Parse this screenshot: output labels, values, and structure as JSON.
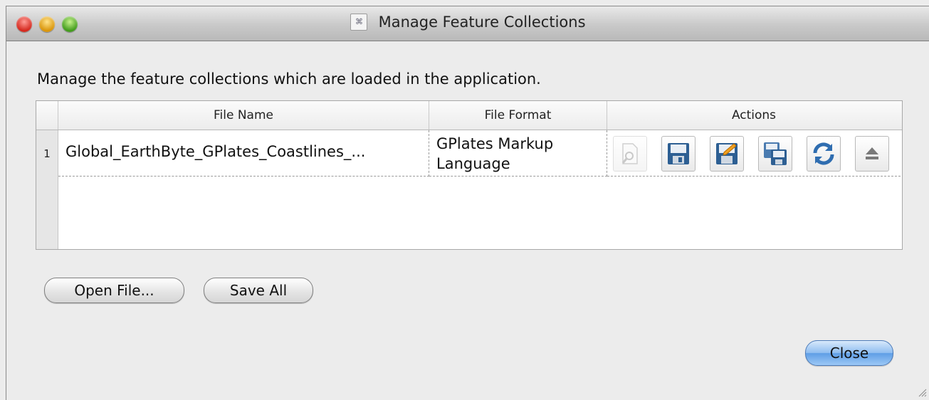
{
  "window": {
    "title": "Manage Feature Collections",
    "title_icon": "app-icon"
  },
  "description": "Manage the feature collections which are loaded in the application.",
  "table": {
    "columns": [
      "File Name",
      "File Format",
      "Actions"
    ],
    "rows": [
      {
        "index": "1",
        "file_name": "Global_EarthByte_GPlates_Coastlines_...",
        "file_format": "GPlates Markup\nLanguage",
        "actions": [
          "edit-configuration-icon",
          "save-icon",
          "save-as-icon",
          "save-copy-icon",
          "reload-icon",
          "unload-icon"
        ]
      }
    ]
  },
  "buttons": {
    "open_file": "Open File...",
    "save_all": "Save All",
    "close": "Close"
  },
  "colors": {
    "close_accent": "#5f9ee6"
  }
}
